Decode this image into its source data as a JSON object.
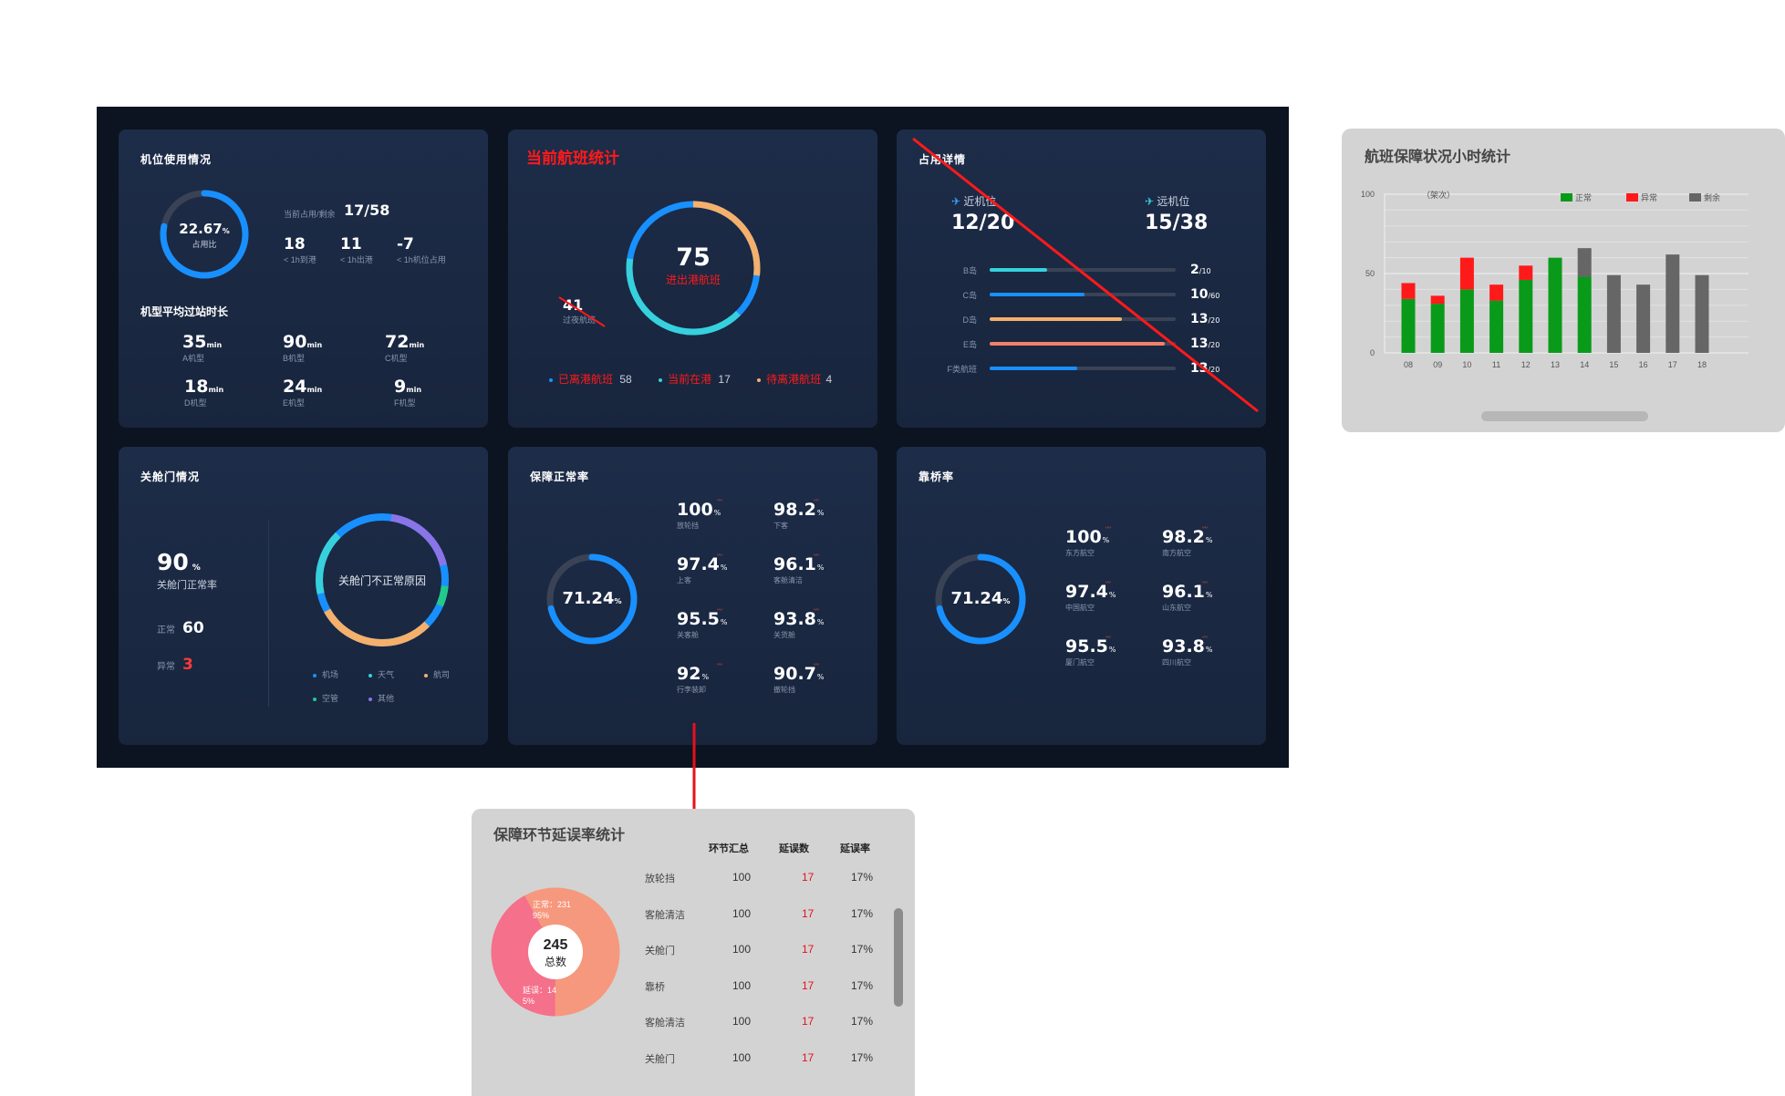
{
  "colors": {
    "board_bg": "#0b1420",
    "panel_bg": "#1b2943",
    "blue": "#1890ff",
    "cyan": "#36d1dc",
    "orange": "#f5b06b",
    "salmon": "#f3806b",
    "red": "#ff1a1a",
    "green": "#0a9a1a",
    "gray_bar": "#666666"
  },
  "stand_usage": {
    "title": "机位使用情况",
    "donut_value": "22.67",
    "donut_unit": "%",
    "donut_label": "占用比",
    "donut_fraction": 0.2267,
    "occupy_label": "当前占用/剩余",
    "occupy_value": "17/58",
    "metrics": [
      {
        "value": "18",
        "label": "< 1h到港"
      },
      {
        "value": "11",
        "label": "< 1h出港"
      },
      {
        "value": "-7",
        "label": "< 1h机位占用"
      }
    ],
    "turn_title": "机型平均过站时长",
    "turn_times": [
      {
        "value": "35",
        "unit": "min",
        "label": "A机型"
      },
      {
        "value": "90",
        "unit": "min",
        "label": "B机型"
      },
      {
        "value": "72",
        "unit": "min",
        "label": "C机型"
      },
      {
        "value": "18",
        "unit": "min",
        "label": "D机型"
      },
      {
        "value": "24",
        "unit": "min",
        "label": "E机型"
      },
      {
        "value": "9",
        "unit": "min",
        "label": "F机型"
      }
    ]
  },
  "flight_stats": {
    "title": "当前航班统计",
    "center_value": "75",
    "center_label": "进出港航班",
    "side_value": "41",
    "side_label": "过夜航班",
    "legend": [
      {
        "label": "已离港航班",
        "value": "58",
        "color": "#1890ff"
      },
      {
        "label": "当前在港",
        "value": "17",
        "color": "#36d1dc"
      },
      {
        "label": "待离港航班",
        "value": "4",
        "color": "#f5b06b"
      }
    ]
  },
  "stand_detail": {
    "title": "占用详情",
    "near_label": "近机位",
    "near_value": "12/20",
    "remote_label": "远机位",
    "remote_value": "15/38",
    "rows": [
      {
        "label": "B岛",
        "value": "2",
        "total": "/10",
        "fraction": 0.31,
        "color": "#36d1dc"
      },
      {
        "label": "C岛",
        "value": "10",
        "total": "/60",
        "fraction": 0.51,
        "color": "#1890ff"
      },
      {
        "label": "D岛",
        "value": "13",
        "total": "/20",
        "fraction": 0.71,
        "color": "#f5b06b"
      },
      {
        "label": "E岛",
        "value": "13",
        "total": "/20",
        "fraction": 0.94,
        "color": "#f3806b"
      },
      {
        "label": "F类航班",
        "value": "13",
        "total": "/20",
        "fraction": 0.47,
        "color": "#1890ff"
      }
    ]
  },
  "door_close": {
    "title": "关舱门情况",
    "rate": "90",
    "rate_unit": "%",
    "rate_label": "关舱门正常率",
    "normal_label": "正常",
    "normal_value": "60",
    "abnormal_label": "异常",
    "abnormal_value": "3",
    "ring_center": "关舱门不正常原因",
    "legend": [
      {
        "label": "机场",
        "color": "#1890ff"
      },
      {
        "label": "天气",
        "color": "#36d1dc"
      },
      {
        "label": "航司",
        "color": "#f5b06b"
      },
      {
        "label": "空管",
        "color": "#22c98a"
      },
      {
        "label": "其他",
        "color": "#8a74e8"
      }
    ]
  },
  "guarantee_rate": {
    "title": "保障正常率",
    "donut_value": "71.24",
    "donut_fraction": 0.7124,
    "unit": "%",
    "items": [
      {
        "value": "100",
        "label": "放轮挡"
      },
      {
        "value": "98.2",
        "label": "下客"
      },
      {
        "value": "97.4",
        "label": "上客"
      },
      {
        "value": "96.1",
        "label": "客舱清洁"
      },
      {
        "value": "95.5",
        "label": "关客舱"
      },
      {
        "value": "93.8",
        "label": "关货舱"
      },
      {
        "value": "92",
        "label": "行李装卸"
      },
      {
        "value": "90.7",
        "label": "撤轮挡"
      }
    ]
  },
  "bridge_rate": {
    "title": "靠桥率",
    "donut_value": "71.24",
    "donut_fraction": 0.7124,
    "unit": "%",
    "items": [
      {
        "value": "100",
        "label": "东方航空"
      },
      {
        "value": "98.2",
        "label": "南方航空"
      },
      {
        "value": "97.4",
        "label": "中国航空"
      },
      {
        "value": "96.1",
        "label": "山东航空"
      },
      {
        "value": "95.5",
        "label": "厦门航空"
      },
      {
        "value": "93.8",
        "label": "四川航空"
      }
    ]
  },
  "hourly_chart": {
    "title": "航班保障状况小时统计"
  },
  "chart_data": {
    "type": "bar",
    "stacked": true,
    "unit_label": "（架次）",
    "categories": [
      "08",
      "09",
      "10",
      "11",
      "12",
      "13",
      "14",
      "15",
      "16",
      "17",
      "18"
    ],
    "ylim": [
      0,
      100
    ],
    "yticks": [
      0,
      50,
      100
    ],
    "grid": true,
    "legend_position": "top-right",
    "series": [
      {
        "name": "正常",
        "color": "#0a9a1a",
        "values": [
          34,
          31,
          40,
          33,
          46,
          60,
          48,
          0,
          0,
          0,
          0
        ]
      },
      {
        "name": "异常",
        "color": "#ff1a1a",
        "values": [
          10,
          5,
          20,
          10,
          9,
          0,
          0,
          0,
          0,
          0,
          0
        ]
      },
      {
        "name": "剩余",
        "color": "#666666",
        "values": [
          0,
          0,
          0,
          0,
          0,
          0,
          18,
          49,
          43,
          62,
          49
        ]
      }
    ]
  },
  "delay_table": {
    "title": "保障环节延误率统计",
    "pie_total": "245",
    "pie_total_label": "总数",
    "pie_normal_label": "正常：231",
    "pie_normal_pct": "95%",
    "pie_delay_label": "延误：14",
    "pie_delay_pct": "5%",
    "headers": [
      "环节汇总",
      "延误数",
      "延误率"
    ],
    "rows": [
      {
        "name": "放轮挡",
        "total": "100",
        "delay": "17",
        "rate": "17%"
      },
      {
        "name": "客舱清洁",
        "total": "100",
        "delay": "17",
        "rate": "17%"
      },
      {
        "name": "关舱门",
        "total": "100",
        "delay": "17",
        "rate": "17%"
      },
      {
        "name": "靠桥",
        "total": "100",
        "delay": "17",
        "rate": "17%"
      },
      {
        "name": "客舱清洁",
        "total": "100",
        "delay": "17",
        "rate": "17%"
      },
      {
        "name": "关舱门",
        "total": "100",
        "delay": "17",
        "rate": "17%"
      }
    ]
  }
}
